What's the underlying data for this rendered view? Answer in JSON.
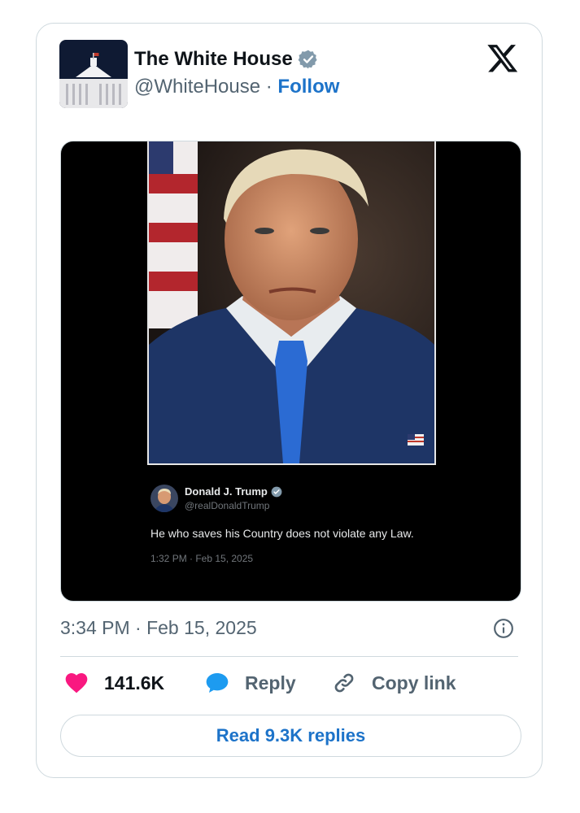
{
  "account": {
    "name": "The White House",
    "handle": "@WhiteHouse",
    "separator": " · ",
    "follow_label": "Follow",
    "avatar_icon": "white-house-avatar",
    "verified_icon": "verified-badge-icon"
  },
  "brand_icon": "x-logo-icon",
  "embedded_post": {
    "author_name": "Donald J. Trump",
    "author_handle": "@realDonaldTrump",
    "text": "He who saves his Country does not violate any Law.",
    "time": "1:32 PM · Feb 15, 2025"
  },
  "timestamp": "3:34 PM · Feb 15, 2025",
  "actions": {
    "like_count": "141.6K",
    "reply_label": "Reply",
    "copy_label": "Copy link"
  },
  "read_replies_label": "Read 9.3K replies",
  "colors": {
    "accent": "#1d73c9",
    "like": "#f91880",
    "reply": "#1d9bf0",
    "muted": "#536471"
  }
}
